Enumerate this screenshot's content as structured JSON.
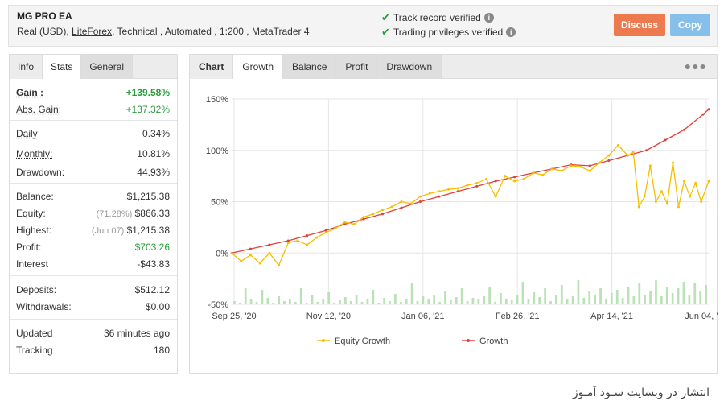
{
  "header": {
    "title": "MG PRO EA",
    "sub_prefix": "Real (USD),",
    "broker": "LiteForex",
    "sub_suffix": ", Technical , Automated , 1:200 , MetaTrader 4",
    "verify1": "Track record verified",
    "verify2": "Trading privileges verified",
    "discuss": "Discuss",
    "copy": "Copy"
  },
  "left_tabs": [
    "Info",
    "Stats",
    "General"
  ],
  "stats": {
    "gain_label": "Gain :",
    "gain": "+139.58%",
    "abs_gain_label": "Abs. Gain:",
    "abs_gain": "+137.32%",
    "daily_label": "Daily",
    "daily": "0.34%",
    "monthly_label": "Monthly:",
    "monthly": "10.81%",
    "drawdown_label": "Drawdown:",
    "drawdown": "44.93%",
    "balance_label": "Balance:",
    "balance": "$1,215.38",
    "equity_label": "Equity:",
    "equity_pct": "(71.28%)",
    "equity": "$866.33",
    "highest_label": "Highest:",
    "highest_date": "(Jun 07)",
    "highest": "$1,215.38",
    "profit_label": "Profit:",
    "profit": "$703.26",
    "interest_label": "Interest",
    "interest": "-$43.83",
    "deposits_label": "Deposits:",
    "deposits": "$512.12",
    "withdrawals_label": "Withdrawals:",
    "withdrawals": "$0.00",
    "updated_label": "Updated",
    "updated": "36 minutes ago",
    "tracking_label": "Tracking",
    "tracking": "180"
  },
  "right_tabs": [
    "Chart",
    "Growth",
    "Balance",
    "Profit",
    "Drawdown"
  ],
  "colors": {
    "growth": "#e0403a",
    "equity": "#f5c000",
    "volume": "#b9e3b4"
  },
  "footer_text": "انتشار در وبسایت سـود آمـوز",
  "chart_data": {
    "type": "line",
    "x_ticks": [
      "Sep 25, '20",
      "Nov 12, '20",
      "Jan 06, '21",
      "Feb 26, '21",
      "Apr 14, '21",
      "Jun 04, '21"
    ],
    "y_ticks": [
      "150%",
      "100%",
      "50%",
      "0%",
      "-50%"
    ],
    "ylim": [
      -50,
      150
    ],
    "legend": [
      "Equity Growth",
      "Growth"
    ],
    "legend_position": "bottom",
    "series": [
      {
        "name": "Growth",
        "color": "#e0403a",
        "x": [
          0,
          10,
          20,
          30,
          40,
          50,
          60,
          70,
          80,
          90,
          100,
          110,
          120,
          130,
          140,
          150,
          160,
          170,
          180,
          190,
          200,
          210,
          220,
          230,
          240,
          250,
          253
        ],
        "values": [
          0,
          4,
          8,
          12,
          17,
          22,
          28,
          33,
          38,
          44,
          50,
          55,
          60,
          65,
          70,
          74,
          78,
          82,
          86,
          85,
          90,
          95,
          100,
          110,
          120,
          135,
          140
        ]
      },
      {
        "name": "Equity Growth",
        "color": "#f5c000",
        "x": [
          0,
          5,
          10,
          15,
          20,
          25,
          30,
          35,
          40,
          45,
          50,
          55,
          60,
          65,
          70,
          75,
          80,
          85,
          90,
          95,
          100,
          105,
          110,
          115,
          120,
          125,
          130,
          135,
          140,
          145,
          150,
          155,
          160,
          165,
          170,
          175,
          180,
          185,
          190,
          195,
          200,
          205,
          210,
          213,
          216,
          219,
          222,
          225,
          228,
          231,
          234,
          237,
          240,
          243,
          246,
          249,
          253
        ],
        "values": [
          0,
          -8,
          -2,
          -10,
          0,
          -12,
          10,
          12,
          8,
          15,
          20,
          24,
          30,
          28,
          35,
          38,
          42,
          45,
          50,
          48,
          55,
          58,
          60,
          62,
          63,
          66,
          68,
          72,
          55,
          75,
          70,
          72,
          78,
          76,
          82,
          80,
          85,
          84,
          80,
          88,
          95,
          105,
          95,
          98,
          45,
          55,
          85,
          50,
          60,
          48,
          88,
          45,
          70,
          55,
          68,
          50,
          70
        ]
      }
    ],
    "volume": [
      4,
      2,
      20,
      6,
      3,
      18,
      8,
      2,
      10,
      4,
      6,
      3,
      20,
      2,
      12,
      3,
      7,
      15,
      2,
      5,
      9,
      4,
      11,
      3,
      6,
      18,
      2,
      8,
      4,
      13,
      3,
      6,
      26,
      4,
      10,
      7,
      12,
      3,
      16,
      5,
      9,
      20,
      4,
      8,
      6,
      10,
      22,
      3,
      14,
      7,
      5,
      11,
      28,
      6,
      15,
      9,
      20,
      4,
      12,
      24,
      6,
      10,
      30,
      8,
      16,
      12,
      20,
      6,
      14,
      18,
      8,
      22,
      10,
      26,
      12,
      16,
      30,
      10,
      22,
      14,
      20,
      28,
      12,
      26,
      16,
      24
    ]
  }
}
